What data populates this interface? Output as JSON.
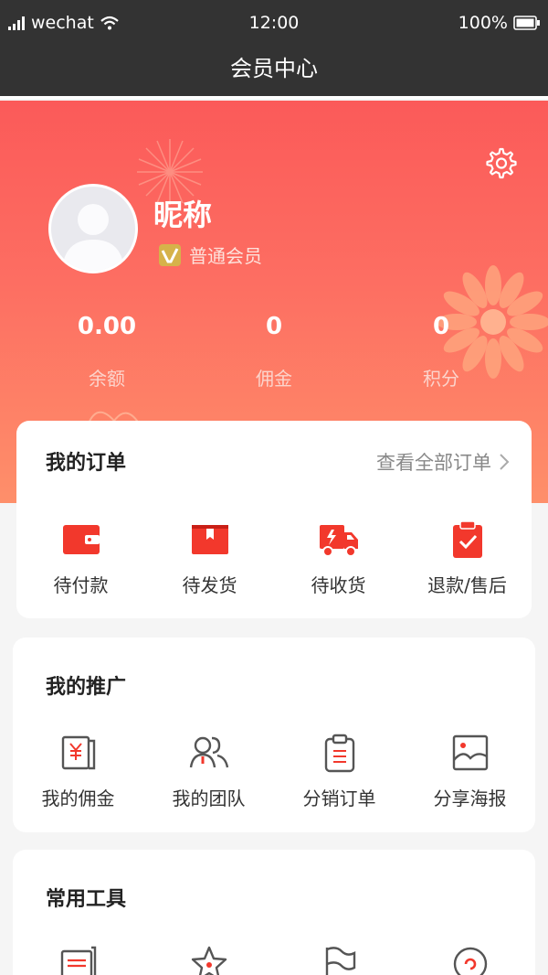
{
  "status_bar": {
    "carrier": "wechat",
    "time": "12:00",
    "battery": "100%"
  },
  "nav": {
    "title": "会员中心"
  },
  "profile": {
    "nickname": "昵称",
    "level": "普通会员",
    "stats": [
      {
        "value": "0.00",
        "label": "余额"
      },
      {
        "value": "0",
        "label": "佣金"
      },
      {
        "value": "0",
        "label": "积分"
      }
    ]
  },
  "orders": {
    "title": "我的订单",
    "view_all": "查看全部订单",
    "items": [
      {
        "label": "待付款",
        "icon": "wallet-icon"
      },
      {
        "label": "待发货",
        "icon": "box-icon"
      },
      {
        "label": "待收货",
        "icon": "truck-icon"
      },
      {
        "label": "退款/售后",
        "icon": "clipboard-check-icon"
      }
    ]
  },
  "promotion": {
    "title": "我的推广",
    "items": [
      {
        "label": "我的佣金",
        "icon": "commission-icon"
      },
      {
        "label": "我的团队",
        "icon": "team-icon"
      },
      {
        "label": "分销订单",
        "icon": "distribution-order-icon"
      },
      {
        "label": "分享海报",
        "icon": "poster-icon"
      }
    ]
  },
  "tools": {
    "title": "常用工具",
    "items": [
      {
        "icon": "card-icon"
      },
      {
        "icon": "star-icon"
      },
      {
        "icon": "flag-icon"
      },
      {
        "icon": "target-icon"
      }
    ]
  },
  "colors": {
    "topbar": "#333333",
    "accent": "#f2382c",
    "hero_top": "#fb5a59",
    "hero_bottom": "#fe8f6a"
  }
}
